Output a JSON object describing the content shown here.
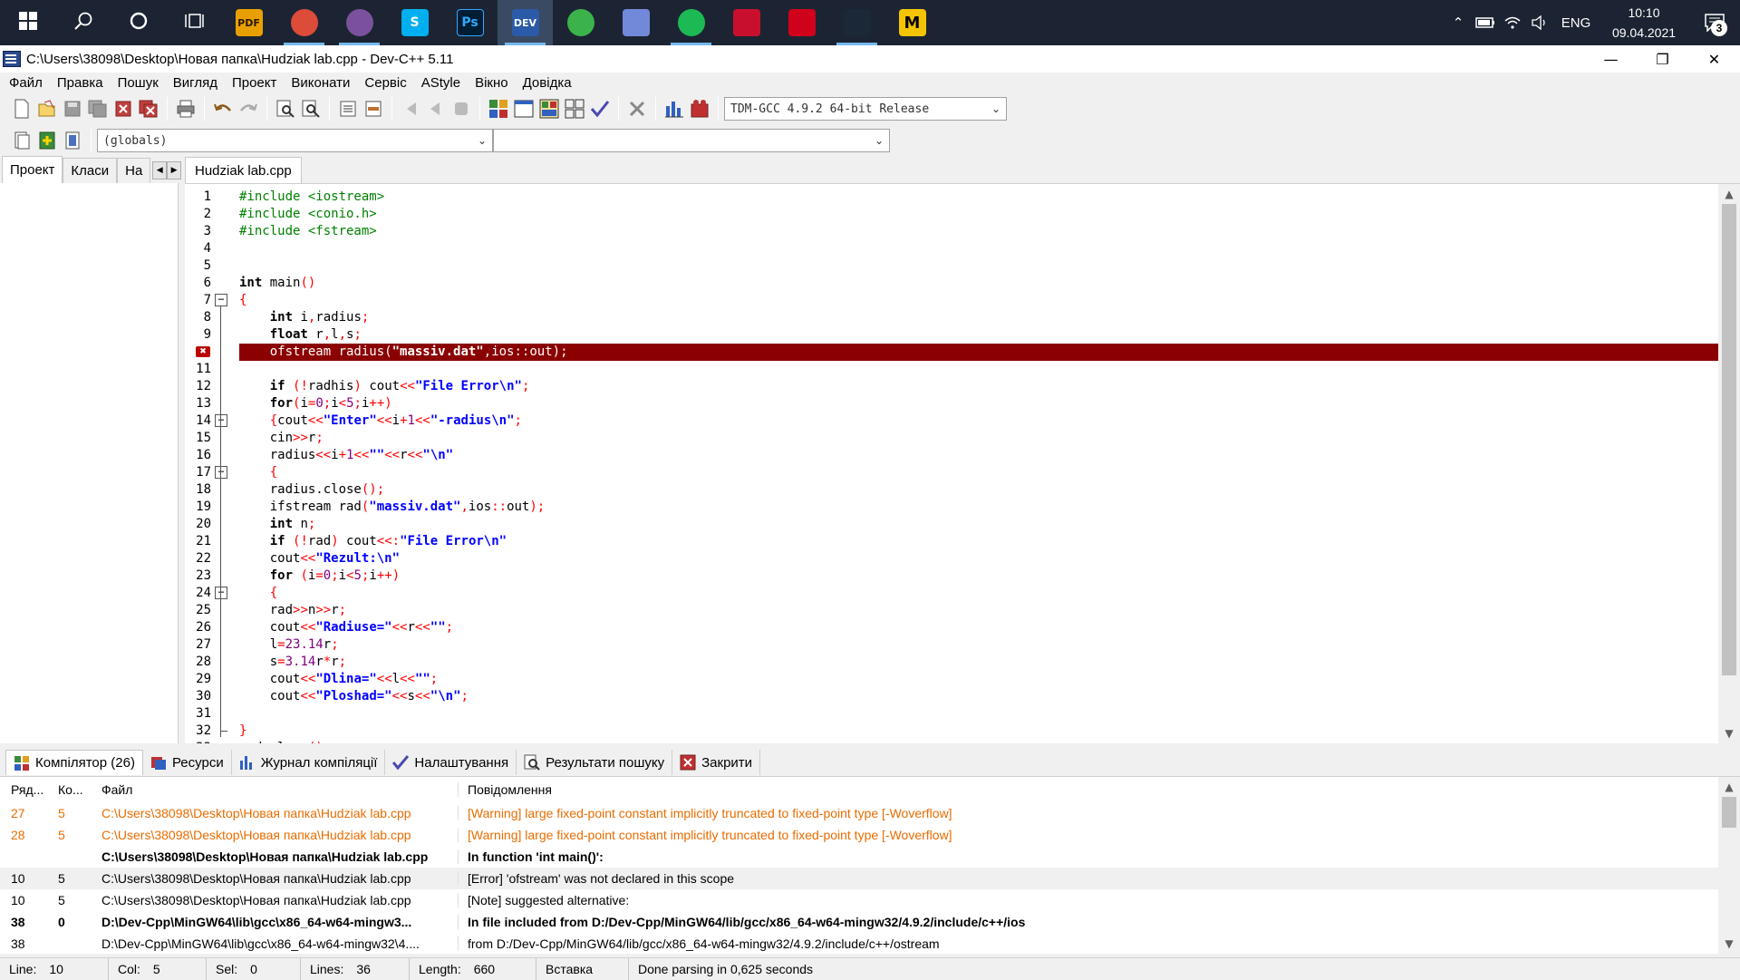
{
  "taskbar": {
    "apps": [
      {
        "name": "windows-start-icon",
        "label": "",
        "color": "#1c2433"
      },
      {
        "name": "search-icon",
        "label": "",
        "color": "#1c2433"
      },
      {
        "name": "cortana-icon",
        "label": "",
        "color": "#1c2433"
      },
      {
        "name": "task-view-icon",
        "label": "",
        "color": "#1c2433"
      },
      {
        "name": "pdf-app-icon",
        "label": "PDF",
        "color": "#e8a000"
      },
      {
        "name": "chrome-icon",
        "label": "",
        "color": "#dd4b39"
      },
      {
        "name": "viber-icon",
        "label": "",
        "color": "#7b519d"
      },
      {
        "name": "skype-icon",
        "label": "S",
        "color": "#00aff0"
      },
      {
        "name": "photoshop-icon",
        "label": "Ps",
        "color": "#001d34"
      },
      {
        "name": "devcpp-icon",
        "label": "DEV",
        "color": "#2b5aa8"
      },
      {
        "name": "utorrent-icon",
        "label": "",
        "color": "#3bb34a"
      },
      {
        "name": "discord-icon",
        "label": "",
        "color": "#7289da"
      },
      {
        "name": "spotify-icon",
        "label": "",
        "color": "#1db954"
      },
      {
        "name": "red-app-icon",
        "label": "",
        "color": "#c8102e"
      },
      {
        "name": "download-app-icon",
        "label": "",
        "color": "#d0021b"
      },
      {
        "name": "steam-icon",
        "label": "",
        "color": "#1b2838"
      },
      {
        "name": "m-app-icon",
        "label": "M",
        "color": "#f5c400"
      }
    ],
    "lang": "ENG",
    "time": "10:10",
    "date": "09.04.2021",
    "notifications": "3"
  },
  "window": {
    "title": "C:\\Users\\38098\\Desktop\\Новая папка\\Hudziak lab.cpp - Dev-C++ 5.11"
  },
  "menu": [
    "Файл",
    "Правка",
    "Пошук",
    "Вигляд",
    "Проект",
    "Виконати",
    "Сервіс",
    "AStyle",
    "Вікно",
    "Довідка"
  ],
  "toolbar": {
    "compiler": "TDM-GCC 4.9.2 64-bit Release",
    "scope": "(globals)",
    "member": ""
  },
  "left_tabs": [
    "Проект",
    "Класи",
    "На"
  ],
  "editor": {
    "tab": "Hudziak lab.cpp",
    "error_line": 10,
    "lines": [
      "#include <iostream>",
      "#include <conio.h>",
      "#include <fstream>",
      "",
      "",
      "int main()",
      "{",
      "    int i,radius;",
      "    float r,l,s;",
      "    ofstream radius(\"massiv.dat\",ios::out);",
      "",
      "    if (!radhis) cout<<\"File Error\\n\";",
      "    for(i=0;i<5;i++)",
      "    {cout<<\"Enter\"<<i+1<<\"-radius\\n\";",
      "    cin>>r;",
      "    radius<<i+1<<\"\"<<r<<\"\\n\"",
      "    {",
      "    radius.close();",
      "    ifstream rad(\"massiv.dat\",ios::out);",
      "    int n;",
      "    if (!rad) cout<<:\"File Error\\n\"",
      "    cout<<\"Rezult:\\n\"",
      "    for (i=0;i<5;i++)",
      "    {",
      "    rad>>n>>r;",
      "    cout<<\"Radiuse=\"<<r<<\"\";",
      "    l=23.14r;",
      "    s=3.14r*r;",
      "    cout<<\"Dlina=\"<<l<<\"\";",
      "    cout<<\"Ploshad=\"<<s<<\"\\n\";",
      "",
      "}",
      "rad.close();"
    ]
  },
  "bottom_tabs": [
    "Компілятор (26)",
    "Ресурси",
    "Журнал компіляції",
    "Налаштування",
    "Результати пошуку",
    "Закрити"
  ],
  "messages": {
    "headers": [
      "Ряд...",
      "Ко...",
      "Файл",
      "Повідомлення"
    ],
    "rows": [
      {
        "line": "27",
        "col": "5",
        "file": "C:\\Users\\38098\\Desktop\\Новая папка\\Hudziak lab.cpp",
        "msg": "[Warning] large fixed-point constant implicitly truncated to fixed-point type [-Woverflow]",
        "style": "warn"
      },
      {
        "line": "28",
        "col": "5",
        "file": "C:\\Users\\38098\\Desktop\\Новая папка\\Hudziak lab.cpp",
        "msg": "[Warning] large fixed-point constant implicitly truncated to fixed-point type [-Woverflow]",
        "style": "warn"
      },
      {
        "line": "",
        "col": "",
        "file": "C:\\Users\\38098\\Desktop\\Новая папка\\Hudziak lab.cpp",
        "msg": "In function 'int main()':",
        "style": "bold"
      },
      {
        "line": "10",
        "col": "5",
        "file": "C:\\Users\\38098\\Desktop\\Новая папка\\Hudziak lab.cpp",
        "msg": "[Error] 'ofstream' was not declared in this scope",
        "style": "alt"
      },
      {
        "line": "10",
        "col": "5",
        "file": "C:\\Users\\38098\\Desktop\\Новая папка\\Hudziak lab.cpp",
        "msg": "[Note] suggested alternative:",
        "style": "normal"
      },
      {
        "line": "38",
        "col": "0",
        "file": "D:\\Dev-Cpp\\MinGW64\\lib\\gcc\\x86_64-w64-mingw3...",
        "msg": "In file included from D:/Dev-Cpp/MinGW64/lib/gcc/x86_64-w64-mingw32/4.9.2/include/c++/ios",
        "style": "bold"
      },
      {
        "line": "38",
        "col": "",
        "file": "D:\\Dev-Cpp\\MinGW64\\lib\\gcc\\x86_64-w64-mingw32\\4....",
        "msg": "                 from D:/Dev-Cpp/MinGW64/lib/gcc/x86_64-w64-mingw32/4.9.2/include/c++/ostream",
        "style": "normal"
      }
    ]
  },
  "status": {
    "line_label": "Line:",
    "line_value": "10",
    "col_label": "Col:",
    "col_value": "5",
    "sel_label": "Sel:",
    "sel_value": "0",
    "lines_label": "Lines:",
    "lines_value": "36",
    "length_label": "Length:",
    "length_value": "660",
    "mode": "Вставка",
    "message": "Done parsing in 0,625 seconds"
  }
}
